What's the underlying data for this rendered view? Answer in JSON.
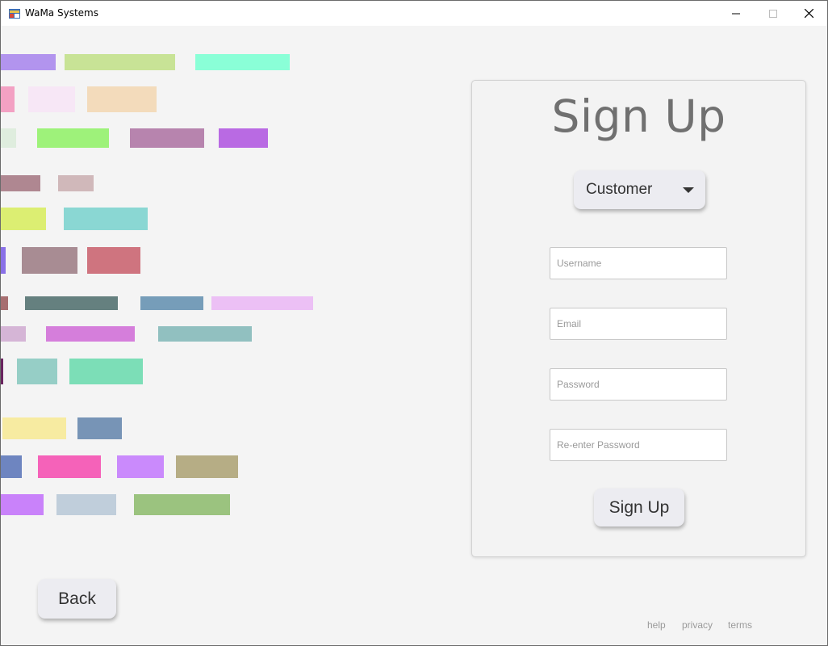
{
  "window": {
    "title": "WaMa Systems",
    "icons": {
      "app": "app-icon",
      "minimize": "minimize-icon",
      "maximize": "maximize-icon",
      "close": "close-icon"
    }
  },
  "form": {
    "title": "Sign Up",
    "account_type": {
      "selected": "Customer",
      "icon": "caret-down-icon"
    },
    "fields": {
      "username": {
        "placeholder": "Username"
      },
      "email": {
        "placeholder": "Email"
      },
      "password": {
        "placeholder": "Password"
      },
      "confirm_password": {
        "placeholder": "Re-enter Password"
      }
    },
    "submit_label": "Sign Up"
  },
  "back_label": "Back",
  "footer": {
    "help": "help",
    "privacy": "privacy",
    "terms": "terms"
  },
  "decoration": {
    "colors": [
      "#b294ee",
      "#c8e396",
      "#8affd7",
      "#f3a1c3",
      "#f7e7f6",
      "#f3dbbb",
      "#dfedde",
      "#9ef27a",
      "#b784ae",
      "#b96ae3",
      "#af8791",
      "#d0b8ba",
      "#dcee72",
      "#8ad7d3",
      "#8970e7",
      "#a88c93",
      "#cf747f",
      "#a76e70",
      "#65807f",
      "#769db9",
      "#ecc0f5",
      "#d5b5d6",
      "#d57edb",
      "#91c0c0",
      "#6a2560",
      "#96cec6",
      "#7cdeb7",
      "#f7eba1",
      "#7794b6",
      "#6e85c0",
      "#f562b9",
      "#ca8afc",
      "#b6ad85",
      "#c982fa",
      "#c0cedb",
      "#9bc37f"
    ]
  }
}
